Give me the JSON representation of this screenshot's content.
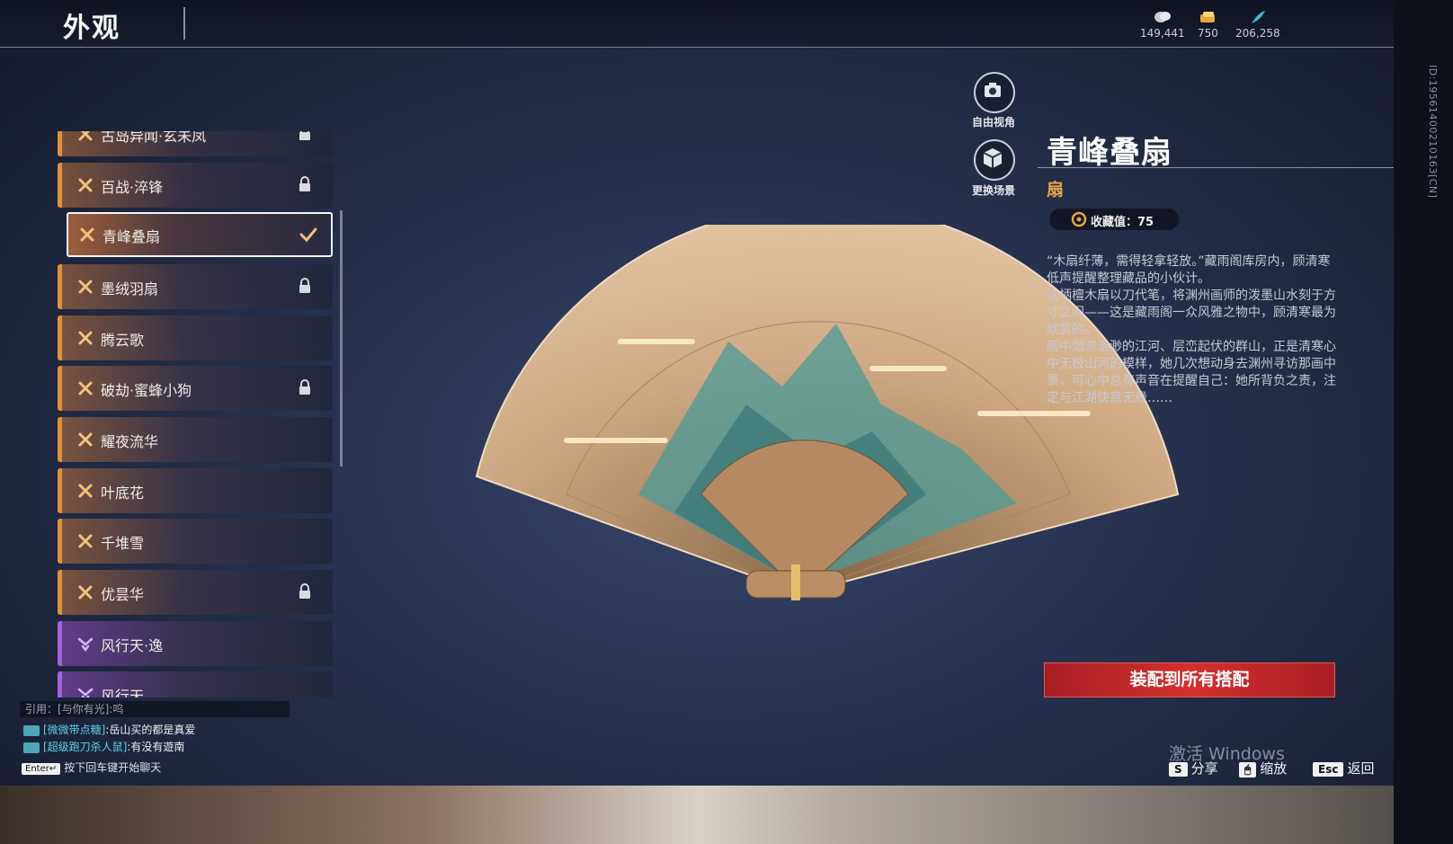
{
  "header": {
    "title": "外观",
    "currencies": [
      {
        "icon": "coin-stack-icon",
        "value": "149,441"
      },
      {
        "icon": "gold-ticket-icon",
        "value": "750"
      },
      {
        "icon": "feather-token-icon",
        "value": "206,258"
      }
    ]
  },
  "side_id": "ID:19561400210163[CN]",
  "list": {
    "items": [
      {
        "label": "古岛异闻·玄未凤",
        "locked": true,
        "color": "orange"
      },
      {
        "label": "百战·淬锋",
        "locked": true,
        "color": "orange"
      },
      {
        "label": "青峰叠扇",
        "selected": true,
        "color": "orange"
      },
      {
        "label": "墨绒羽扇",
        "locked": true,
        "color": "orange"
      },
      {
        "label": "腾云歌",
        "color": "orange"
      },
      {
        "label": "破劫·蜜蜂小狗",
        "locked": true,
        "color": "orange"
      },
      {
        "label": "耀夜流华",
        "color": "orange"
      },
      {
        "label": "叶底花",
        "color": "orange"
      },
      {
        "label": "千堆雪",
        "color": "orange"
      },
      {
        "label": "优昙华",
        "locked": true,
        "color": "orange"
      },
      {
        "label": "风行天·逸",
        "color": "purple"
      },
      {
        "label": "风行天",
        "color": "purple"
      }
    ]
  },
  "view_buttons": {
    "free_view": "自由视角",
    "change_scene": "更换场景"
  },
  "detail": {
    "name": "青峰叠扇",
    "type": "扇",
    "collect_value": "收藏值：75",
    "description": [
      "“木扇纤薄，需得轻拿轻放。”藏雨阁库房内，顾清寒低声提醒整理藏品的小伙计。",
      "这柄檀木扇以刀代笔，将渊州画师的泼墨山水刻于方寸之间——这是藏雨阁一众风雅之物中，顾清寒最为欣赏的。",
      "画中烟波浩渺的江河、层峦起伏的群山，正是清寒心中无极山河的模样，她几次想动身去渊州寻访那画中景，可心中总有声音在提醒自己：她所背负之责，注定与江湖快意无缘……"
    ],
    "equip_button": "装配到所有搭配"
  },
  "chat": {
    "quote": "引用：[与你有光]:呜",
    "lines": [
      {
        "who": "[微微带点糖]",
        "msg": ":岳山买的都是真爱"
      },
      {
        "who": "[超级跑刀杀人鼠]",
        "msg": ":有没有遊南"
      }
    ],
    "enter_key": "Enter↵",
    "enter_hint": "按下回车键开始聊天"
  },
  "watermark": "激活 Windows",
  "hints": [
    {
      "key": "S",
      "label": "分享"
    },
    {
      "key": "🖱",
      "label": "缩放"
    },
    {
      "key": "Esc",
      "label": "返回"
    }
  ],
  "colors": {
    "accent_orange": "#e08f3a",
    "accent_purple": "#a263e0",
    "equip_red": "#c8282a",
    "type_gold": "#e9a64a"
  }
}
